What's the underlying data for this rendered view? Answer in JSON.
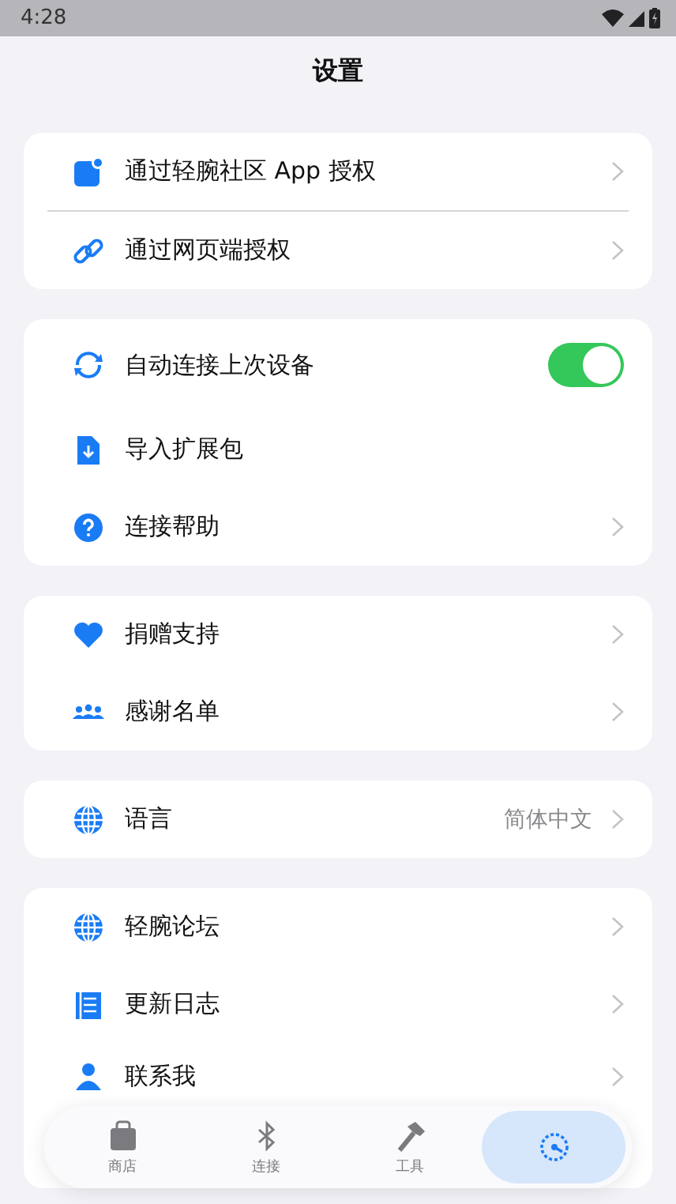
{
  "status_bar": {
    "time": "4:28"
  },
  "title": "设置",
  "sections": [
    {
      "items": [
        {
          "label": "通过轻腕社区 App 授权",
          "kind": "link",
          "divider": true
        },
        {
          "label": "通过网页端授权",
          "kind": "link"
        }
      ]
    },
    {
      "items": [
        {
          "label": "自动连接上次设备",
          "kind": "toggle",
          "on": true
        },
        {
          "label": "导入扩展包",
          "kind": "action"
        },
        {
          "label": "连接帮助",
          "kind": "link"
        }
      ]
    },
    {
      "items": [
        {
          "label": "捐赠支持",
          "kind": "link"
        },
        {
          "label": "感谢名单",
          "kind": "link"
        }
      ]
    },
    {
      "items": [
        {
          "label": "语言",
          "kind": "value",
          "value": "简体中文"
        }
      ]
    },
    {
      "items": [
        {
          "label": "轻腕论坛",
          "kind": "link"
        },
        {
          "label": "更新日志",
          "kind": "link"
        },
        {
          "label": "联系我",
          "kind": "link"
        }
      ]
    }
  ],
  "tabs": [
    {
      "label": "商店",
      "selected": false
    },
    {
      "label": "连接",
      "selected": false
    },
    {
      "label": "工具",
      "selected": false
    },
    {
      "selected": true
    }
  ]
}
